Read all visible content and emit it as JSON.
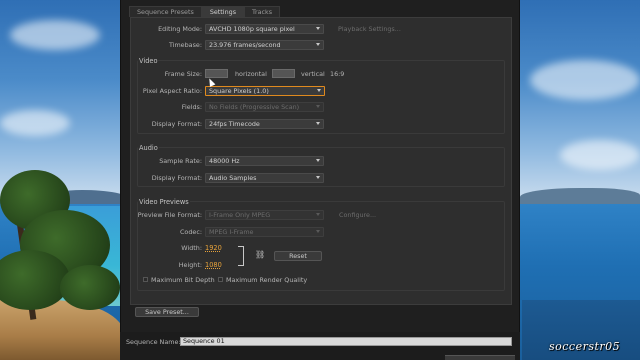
{
  "colors": {
    "dialog_bg": "#1f1f1f",
    "panel_bg": "#2e2e2e",
    "accent_orange": "#e8a33a",
    "focus_border": "#e08a1e"
  },
  "tabs": [
    {
      "label": "Sequence Presets",
      "active": false
    },
    {
      "label": "Settings",
      "active": true
    },
    {
      "label": "Tracks",
      "active": false
    }
  ],
  "general": {
    "editing_mode_label": "Editing Mode:",
    "editing_mode_value": "AVCHD 1080p square pixel",
    "playback_settings": "Playback Settings...",
    "timebase_label": "Timebase:",
    "timebase_value": "23.976 frames/second"
  },
  "video": {
    "title": "Video",
    "frame_size_label": "Frame Size:",
    "horizontal": "horizontal",
    "vertical": "vertical",
    "aspect": "16:9",
    "pixel_aspect_label": "Pixel Aspect Ratio:",
    "pixel_aspect_value": "Square Pixels (1.0)",
    "fields_label": "Fields:",
    "fields_value": "No Fields (Progressive Scan)",
    "display_format_label": "Display Format:",
    "display_format_value": "24fps Timecode"
  },
  "audio": {
    "title": "Audio",
    "sample_rate_label": "Sample Rate:",
    "sample_rate_value": "48000 Hz",
    "display_format_label": "Display Format:",
    "display_format_value": "Audio Samples"
  },
  "previews": {
    "title": "Video Previews",
    "file_format_label": "Preview File Format:",
    "file_format_value": "I-Frame Only MPEG",
    "configure": "Configure...",
    "codec_label": "Codec:",
    "codec_value": "MPEG I-Frame",
    "width_label": "Width:",
    "width_value": "1920",
    "height_label": "Height:",
    "height_value": "1080",
    "reset": "Reset",
    "max_bit_depth": "Maximum Bit Depth",
    "max_render_quality": "Maximum Render Quality"
  },
  "save_preset": "Save Preset...",
  "sequence_name_label": "Sequence Name:",
  "sequence_name_value": "Sequence 01",
  "watermark": "soccerstr05",
  "icons": {
    "link": "chain-link-icon",
    "dropdown": "chevron-down-icon",
    "cursor": "mouse-pointer-icon"
  }
}
